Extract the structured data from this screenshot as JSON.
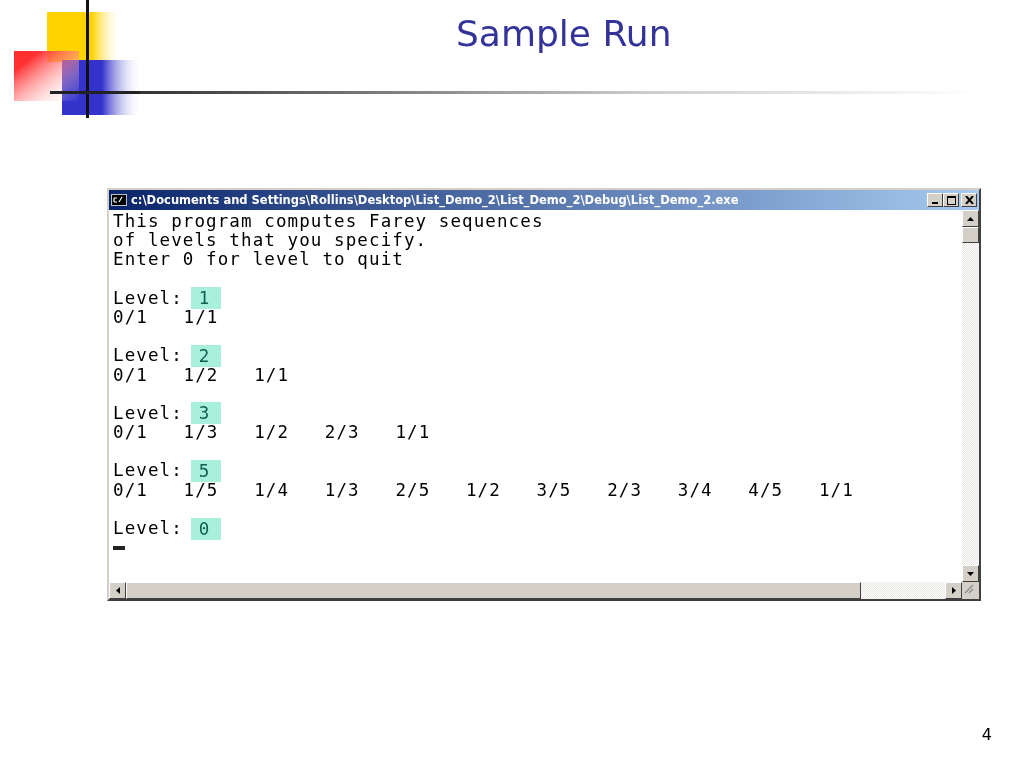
{
  "slide": {
    "title": "Sample Run",
    "number": "4"
  },
  "console": {
    "title": "c:\\Documents and Settings\\Rollins\\Desktop\\List_Demo_2\\List_Demo_2\\Debug\\List_Demo_2.exe",
    "lines": [
      {
        "kind": "text",
        "text": "This program computes Farey sequences"
      },
      {
        "kind": "text",
        "text": "of levels that you specify."
      },
      {
        "kind": "text",
        "text": "Enter 0 for level to quit"
      },
      {
        "kind": "blank"
      },
      {
        "kind": "prompt",
        "label": "Level:",
        "input": "1"
      },
      {
        "kind": "fractions",
        "items": [
          "0/1",
          "1/1"
        ]
      },
      {
        "kind": "blank"
      },
      {
        "kind": "prompt",
        "label": "Level:",
        "input": "2"
      },
      {
        "kind": "fractions",
        "items": [
          "0/1",
          "1/2",
          "1/1"
        ]
      },
      {
        "kind": "blank"
      },
      {
        "kind": "prompt",
        "label": "Level:",
        "input": "3"
      },
      {
        "kind": "fractions",
        "items": [
          "0/1",
          "1/3",
          "1/2",
          "2/3",
          "1/1"
        ]
      },
      {
        "kind": "blank"
      },
      {
        "kind": "prompt",
        "label": "Level:",
        "input": "5"
      },
      {
        "kind": "fractions",
        "items": [
          "0/1",
          "1/5",
          "1/4",
          "1/3",
          "2/5",
          "1/2",
          "3/5",
          "2/3",
          "3/4",
          "4/5",
          "1/1"
        ]
      },
      {
        "kind": "blank"
      },
      {
        "kind": "prompt",
        "label": "Level:",
        "input": "0"
      },
      {
        "kind": "cursor"
      }
    ]
  }
}
